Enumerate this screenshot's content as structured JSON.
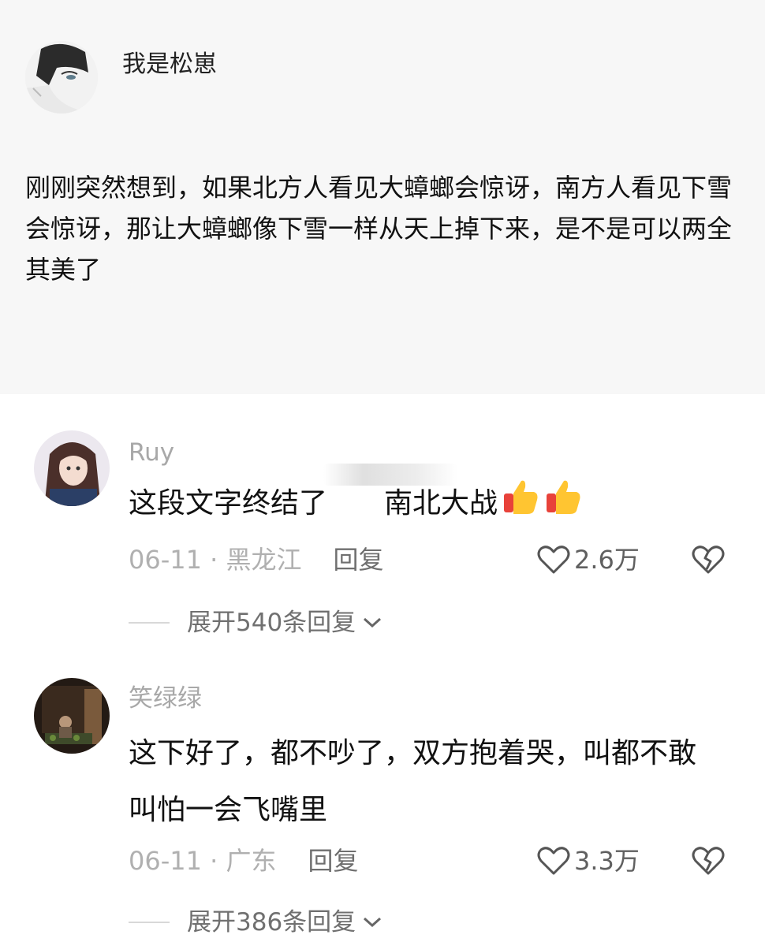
{
  "post": {
    "author": "我是松崽",
    "text": "刚刚突然想到，如果北方人看见大蟑螂会惊讶，南方人看见下雪会惊讶，那让大蟑螂像下雪一样从天上掉下来，是不是可以两全其美了"
  },
  "comments": [
    {
      "username": "Ruy",
      "text": "这段文字终结了　　南北大战",
      "date_location": "06-11 · 黑龙江",
      "reply_label": "回复",
      "likes": "2.6万",
      "expand_label": "展开540条回复",
      "icons": [
        "thumbs-up-icon",
        "thumbs-up-icon"
      ]
    },
    {
      "username": "笑绿绿",
      "text": "这下好了，都不吵了，双方抱着哭，叫都不敢叫怕一会飞嘴里",
      "date_location": "06-11 · 广东",
      "reply_label": "回复",
      "likes": "3.3万",
      "expand_label": "展开386条回复"
    }
  ],
  "icons": {
    "like": "heart-outline-icon",
    "dislike": "broken-heart-icon",
    "expand": "chevron-down-icon"
  }
}
